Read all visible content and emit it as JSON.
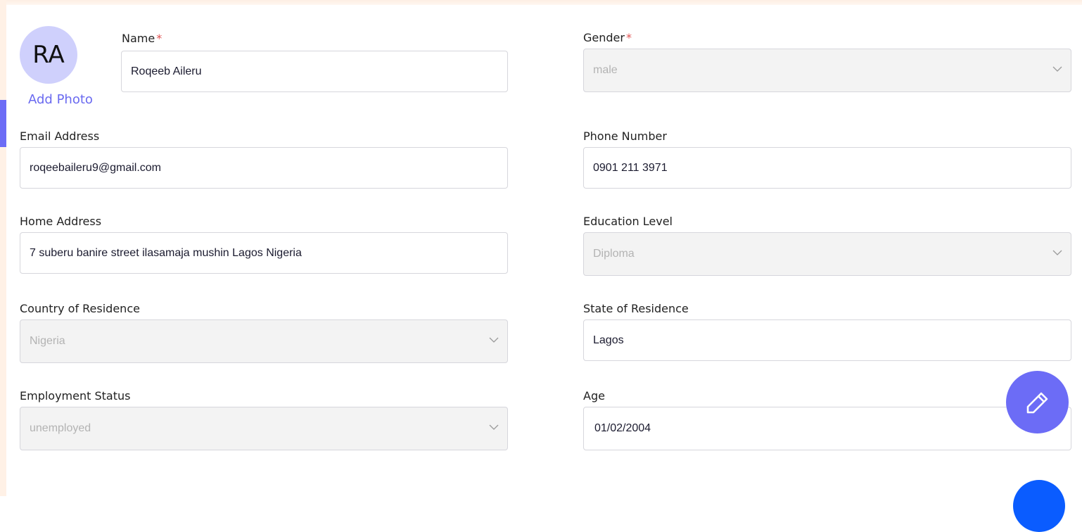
{
  "avatar": {
    "initials": "RA",
    "add_photo_label": "Add Photo"
  },
  "fields": {
    "name": {
      "label": "Name",
      "required_mark": "*",
      "value": "Roqeeb Aileru"
    },
    "gender": {
      "label": "Gender",
      "required_mark": "*",
      "value": "male"
    },
    "email": {
      "label": "Email Address",
      "value": "roqeebaileru9@gmail.com"
    },
    "phone": {
      "label": "Phone Number",
      "value": "0901 211 3971"
    },
    "home_address": {
      "label": "Home Address",
      "value": "7 suberu banire street ilasamaja mushin Lagos Nigeria"
    },
    "education": {
      "label": "Education Level",
      "value": "Diploma"
    },
    "country": {
      "label": "Country of Residence",
      "value": "Nigeria"
    },
    "state": {
      "label": "State of Residence",
      "value": "Lagos"
    },
    "employment": {
      "label": "Employment Status",
      "value": "unemployed"
    },
    "age": {
      "label": "Age",
      "value": "01/02/2004"
    }
  },
  "icons": {
    "edit": "pencil-icon",
    "select": "chevron-down-icon"
  },
  "colors": {
    "accent": "#6c6cf6",
    "fab_blue": "#0a5cff",
    "avatar_bg": "#cfd0fc",
    "required": "#e05252"
  }
}
